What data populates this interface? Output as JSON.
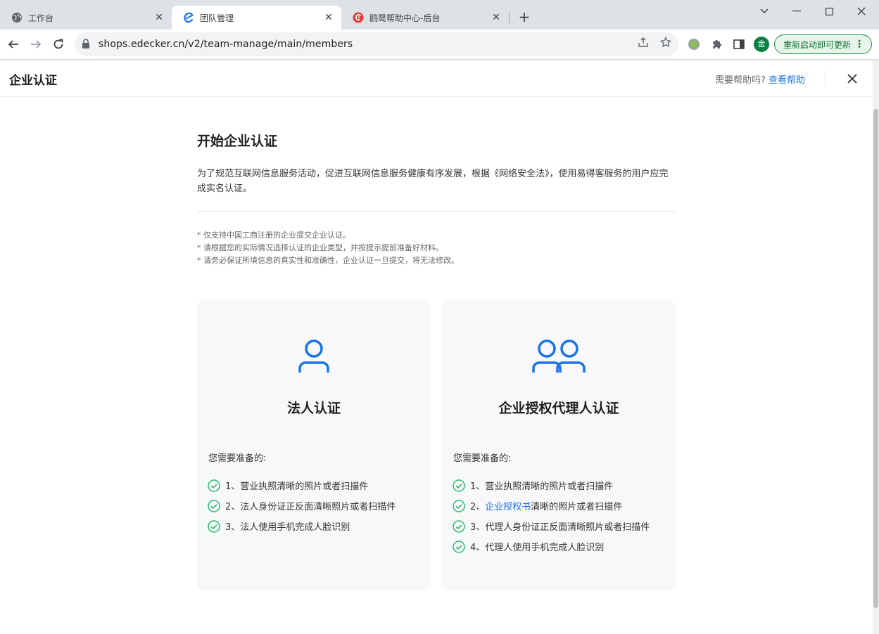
{
  "browser": {
    "tabs": [
      {
        "label": "工作台",
        "active": false,
        "icon": "globe-icon"
      },
      {
        "label": "团队管理",
        "active": true,
        "icon": "edecker-e-icon"
      },
      {
        "label": "鸥鹭帮助中心-后台",
        "active": false,
        "icon": "edecker-red-icon"
      }
    ],
    "new_tab_label": "+",
    "url": "shops.edecker.cn/v2/team-manage/main/members",
    "profile_initial": "金",
    "update_button": "重新启动即可更新"
  },
  "page": {
    "title": "企业认证",
    "help_prompt": "需要帮助吗?",
    "help_link": "查看帮助"
  },
  "main": {
    "heading": "开始企业认证",
    "intro": "为了规范互联网信息服务活动，促进互联网信息服务健康有序发展，根据《网络安全法》，使用易得客服务的用户应完成实名认证。",
    "notes": [
      "* 仅支持中国工商注册的企业提交企业认证。",
      "* 请根据您的实际情况选择认证的企业类型，并按提示提前准备好材料。",
      "* 请务必保证所填信息的真实性和准确性，企业认证一旦提交，将无法修改。"
    ]
  },
  "cards": [
    {
      "title": "法人认证",
      "icon": "person-icon",
      "prepare_label": "您需要准备的:",
      "items": [
        {
          "prefix": "1、",
          "link": "",
          "text": "营业执照清晰的照片或者扫描件"
        },
        {
          "prefix": "2、",
          "link": "",
          "text": "法人身份证正反面清晰照片或者扫描件"
        },
        {
          "prefix": "3、",
          "link": "",
          "text": "法人使用手机完成人脸识别"
        }
      ]
    },
    {
      "title": "企业授权代理人认证",
      "icon": "two-persons-icon",
      "prepare_label": "您需要准备的:",
      "items": [
        {
          "prefix": "1、",
          "link": "",
          "text": "营业执照清晰的照片或者扫描件"
        },
        {
          "prefix": "2、",
          "link": "企业授权书",
          "text": "清晰的照片或者扫描件"
        },
        {
          "prefix": "3、",
          "link": "",
          "text": "代理人身份证正反面清晰照片或者扫描件"
        },
        {
          "prefix": "4、",
          "link": "",
          "text": "代理人使用手机完成人脸识别"
        }
      ]
    }
  ],
  "colors": {
    "accent_blue": "#1a73e8",
    "check_green": "#2bbb6d",
    "card_bg": "#f7f8fa",
    "update_green": "#137333"
  }
}
